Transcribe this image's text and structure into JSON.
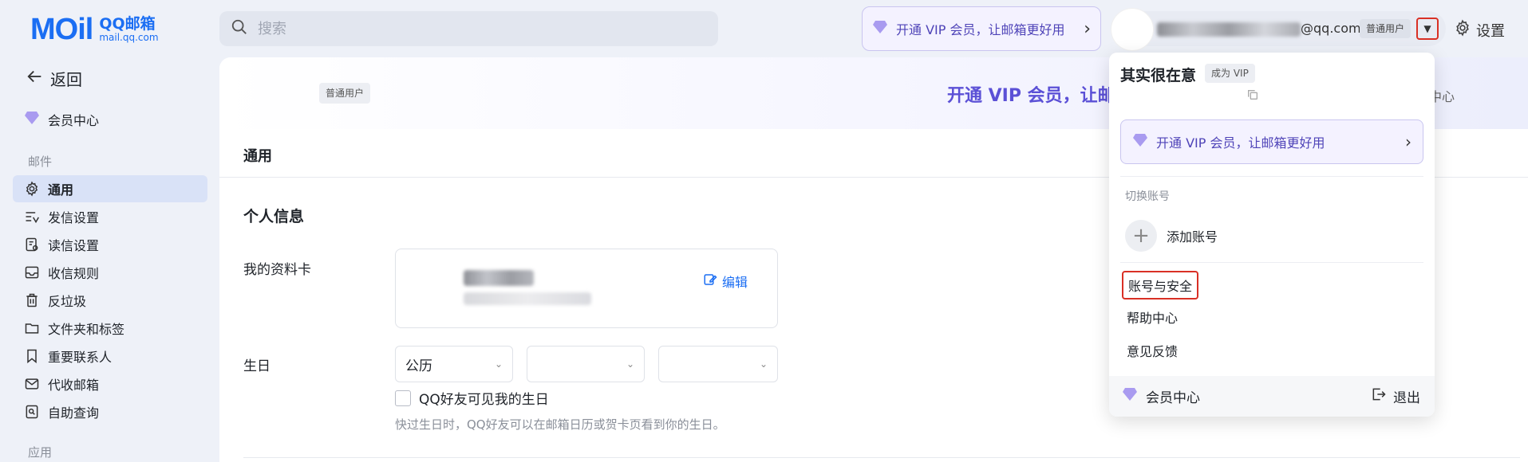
{
  "header": {
    "logo_mark": "MOil",
    "logo_name": "QQ邮箱",
    "logo_url": "mail.qq.com",
    "search_placeholder": "搜索",
    "vip_banner": "开通 VIP 会员，让邮箱更好用",
    "email_suffix": "@qq.com",
    "tier": "普通用户",
    "settings": "设置"
  },
  "sidebar": {
    "back": "返回",
    "vip_center": "会员中心",
    "section_mail": "邮件",
    "items": [
      {
        "label": "通用",
        "icon": "gear-icon",
        "active": true
      },
      {
        "label": "发信设置",
        "icon": "send-settings-icon"
      },
      {
        "label": "读信设置",
        "icon": "read-settings-icon"
      },
      {
        "label": "收信规则",
        "icon": "inbox-rules-icon"
      },
      {
        "label": "反垃圾",
        "icon": "trash-icon"
      },
      {
        "label": "文件夹和标签",
        "icon": "folder-icon"
      },
      {
        "label": "重要联系人",
        "icon": "bookmark-icon"
      },
      {
        "label": "代收邮箱",
        "icon": "mail-collect-icon"
      },
      {
        "label": "自助查询",
        "icon": "self-query-icon"
      }
    ],
    "section_apps": "应用"
  },
  "main": {
    "tier_badge": "普通用户",
    "promo": "开通 VIP 会员，让邮",
    "member_center_link": "员中心",
    "general_title": "通用",
    "personal_info_title": "个人信息",
    "profile_card_label": "我的资料卡",
    "edit_label": "编辑",
    "birthday_label": "生日",
    "calendar_select": "公历",
    "month_select": "",
    "day_select": "",
    "checkbox_label": "QQ好友可见我的生日",
    "hint": "快过生日时，QQ好友可以在邮箱日历或贺卡页看到你的生日。"
  },
  "dropdown": {
    "name": "其实很在意",
    "become_vip": "成为 VIP",
    "vip_banner": "开通 VIP 会员，让邮箱更好用",
    "switch_label": "切换账号",
    "add_account": "添加账号",
    "account_security": "账号与安全",
    "help_center": "帮助中心",
    "feedback": "意见反馈",
    "member_center": "会员中心",
    "logout": "退出"
  }
}
